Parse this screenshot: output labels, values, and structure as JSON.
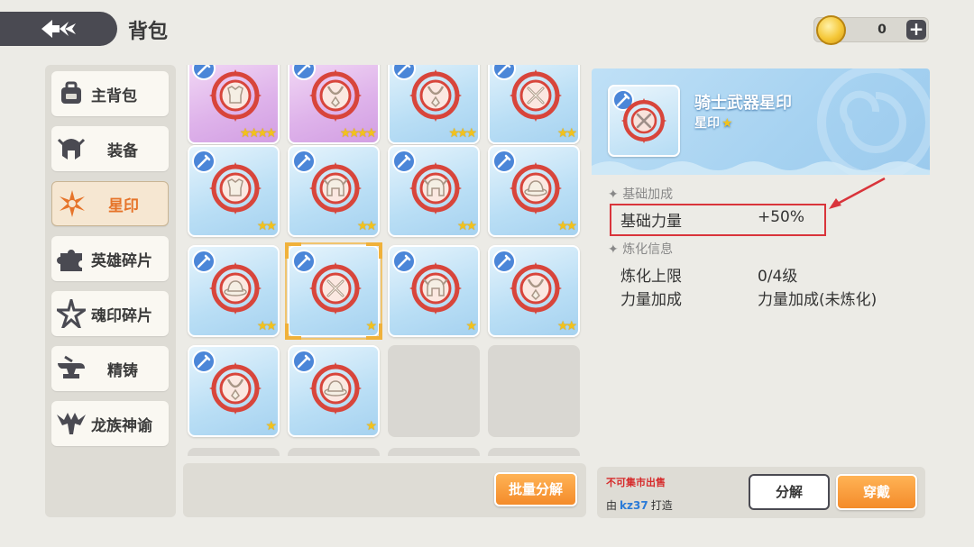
{
  "header": {
    "title": "背包",
    "back_icon": "back-arrow-icon",
    "coin_icon": "gold-coin-icon",
    "coin_value": "0",
    "add_label": "+"
  },
  "sidebar": {
    "items": [
      {
        "label": "主背包",
        "icon": "backpack-icon",
        "active": false
      },
      {
        "label": "装备",
        "icon": "helmet-icon",
        "active": false
      },
      {
        "label": "星印",
        "icon": "star-burst-icon",
        "active": true
      },
      {
        "label": "英雄碎片",
        "icon": "puzzle-icon",
        "active": false
      },
      {
        "label": "魂印碎片",
        "icon": "spiky-star-icon",
        "active": false
      },
      {
        "label": "精铸",
        "icon": "anvil-icon",
        "active": false
      },
      {
        "label": "龙族神谕",
        "icon": "dragon-icon",
        "active": false
      }
    ]
  },
  "grid": {
    "rows": [
      [
        {
          "bg": "purple",
          "emblem": "armor",
          "stars": 4
        },
        {
          "bg": "purple",
          "emblem": "necklace",
          "stars": 4
        },
        {
          "bg": "blue",
          "emblem": "necklace",
          "stars": 3
        },
        {
          "bg": "blue",
          "emblem": "swords",
          "stars": 2
        }
      ],
      [
        {
          "bg": "blue",
          "emblem": "armor",
          "stars": 2
        },
        {
          "bg": "blue",
          "emblem": "helmet",
          "stars": 2
        },
        {
          "bg": "blue",
          "emblem": "helmet",
          "stars": 2
        },
        {
          "bg": "blue",
          "emblem": "hat",
          "stars": 2
        }
      ],
      [
        {
          "bg": "blue",
          "emblem": "hat",
          "stars": 2
        },
        {
          "bg": "blue",
          "emblem": "swords",
          "stars": 1,
          "selected": true
        },
        {
          "bg": "blue",
          "emblem": "helmet",
          "stars": 1
        },
        {
          "bg": "blue",
          "emblem": "necklace",
          "stars": 2
        }
      ],
      [
        {
          "bg": "blue",
          "emblem": "necklace",
          "stars": 1
        },
        {
          "bg": "blue",
          "emblem": "hat",
          "stars": 1
        },
        {
          "bg": "empty"
        },
        {
          "bg": "empty"
        }
      ]
    ],
    "batch_button": "批量分解"
  },
  "detail": {
    "name": "骑士武器星印",
    "type": "星印",
    "type_stars": "★",
    "section_base": "基础加成",
    "base_label": "基础力量",
    "base_value": "+50%",
    "section_refine": "炼化信息",
    "refine_limit_label": "炼化上限",
    "refine_limit_value": "0/4级",
    "power_bonus_label": "力量加成",
    "power_bonus_value": "力量加成(未炼化)",
    "section_marker": "✦",
    "no_trade": "不可集市出售",
    "maker_prefix": "由",
    "maker_name": "kz37",
    "maker_suffix": "打造",
    "split_button": "分解",
    "wear_button": "穿戴"
  },
  "colors": {
    "accent": "#f48b2a",
    "highlight": "#d9343b",
    "badge_blue": "#4b86d8",
    "star": "#f2c21c"
  }
}
